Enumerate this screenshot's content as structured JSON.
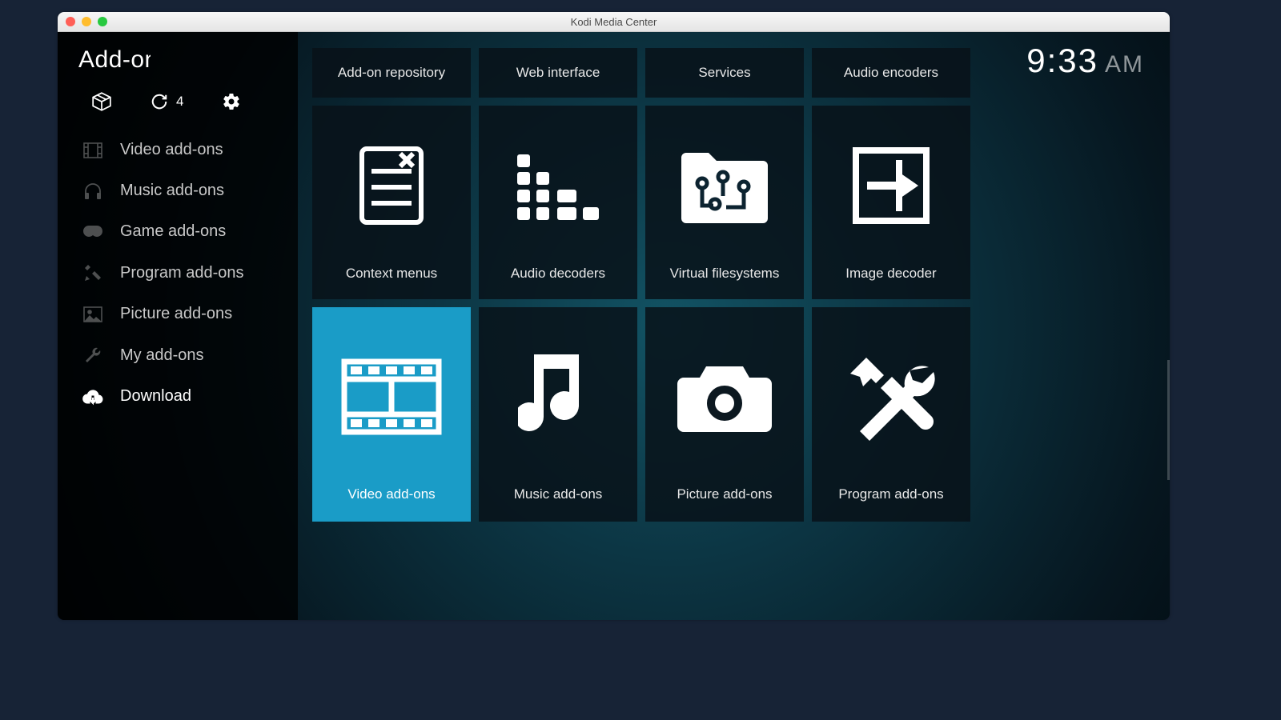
{
  "window": {
    "title": "Kodi Media Center"
  },
  "header": {
    "title": "Add-ons",
    "clock_time": "9:33",
    "clock_ampm": "AM"
  },
  "toolbar": {
    "update_count": "4"
  },
  "sidebar": {
    "items": [
      {
        "label": "Video add-ons",
        "icon": "film-icon"
      },
      {
        "label": "Music add-ons",
        "icon": "headphones-icon"
      },
      {
        "label": "Game add-ons",
        "icon": "gamepad-icon"
      },
      {
        "label": "Program add-ons",
        "icon": "tools-icon"
      },
      {
        "label": "Picture add-ons",
        "icon": "picture-icon"
      },
      {
        "label": "My add-ons",
        "icon": "wrench-icon"
      },
      {
        "label": "Download",
        "icon": "download-icon"
      }
    ],
    "active_index": 6
  },
  "grid": {
    "row_top": [
      {
        "label": "Add-on repository"
      },
      {
        "label": "Web interface"
      },
      {
        "label": "Services"
      },
      {
        "label": "Audio encoders"
      }
    ],
    "row_mid": [
      {
        "label": "Context menus",
        "icon": "context-menu-icon"
      },
      {
        "label": "Audio decoders",
        "icon": "equalizer-icon"
      },
      {
        "label": "Virtual filesystems",
        "icon": "folder-circuit-icon"
      },
      {
        "label": "Image decoder",
        "icon": "image-decoder-icon"
      }
    ],
    "row_bot": [
      {
        "label": "Video add-ons",
        "icon": "film-icon",
        "selected": true
      },
      {
        "label": "Music add-ons",
        "icon": "music-note-icon"
      },
      {
        "label": "Picture add-ons",
        "icon": "camera-icon"
      },
      {
        "label": "Program add-ons",
        "icon": "tools-icon"
      }
    ]
  }
}
